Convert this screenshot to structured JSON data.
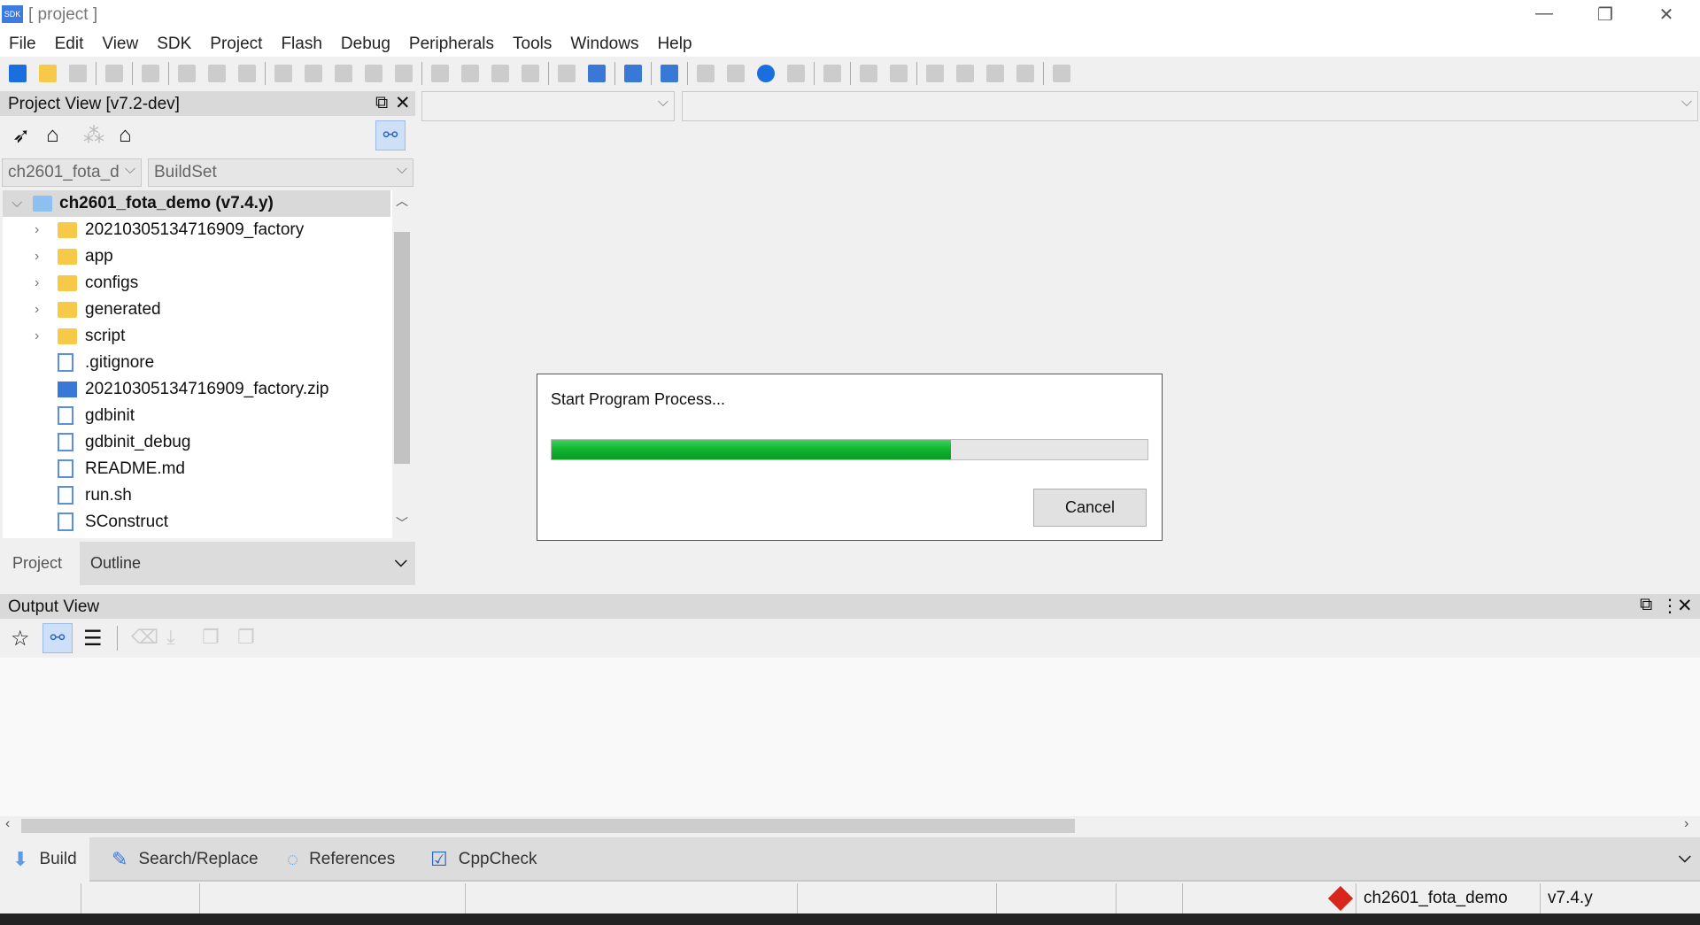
{
  "window": {
    "title": "[ project ]",
    "logo": "SDK",
    "min": "—",
    "restore": "❐",
    "close": "✕"
  },
  "menu": [
    "File",
    "Edit",
    "View",
    "SDK",
    "Project",
    "Flash",
    "Debug",
    "Peripherals",
    "Tools",
    "Windows",
    "Help"
  ],
  "project_view": {
    "title": "Project View [v7.2-dev]",
    "project_combo": "ch2601_fota_d",
    "buildset_combo": "BuildSet",
    "root": "ch2601_fota_demo (v7.4.y)",
    "items": [
      {
        "label": "20210305134716909_factory",
        "type": "folder"
      },
      {
        "label": "app",
        "type": "folder"
      },
      {
        "label": "configs",
        "type": "folder"
      },
      {
        "label": "generated",
        "type": "folder"
      },
      {
        "label": "script",
        "type": "folder"
      },
      {
        "label": ".gitignore",
        "type": "file"
      },
      {
        "label": "20210305134716909_factory.zip",
        "type": "zip"
      },
      {
        "label": "gdbinit",
        "type": "file"
      },
      {
        "label": "gdbinit_debug",
        "type": "file"
      },
      {
        "label": "README.md",
        "type": "file"
      },
      {
        "label": "run.sh",
        "type": "file"
      },
      {
        "label": "SConstruct",
        "type": "file"
      }
    ],
    "tabs": [
      "Project",
      "Outline"
    ]
  },
  "dialog": {
    "message": "Start Program Process...",
    "progress": 0.67,
    "cancel": "Cancel",
    "progress_color": "#0fb32e"
  },
  "output_view": {
    "title": "Output View"
  },
  "bottom_tabs": [
    "Build",
    "Search/Replace",
    "References",
    "CppCheck"
  ],
  "status": {
    "branch": "ch2601_fota_demo",
    "version": "v7.4.y",
    "git_color": "#d9261c"
  }
}
